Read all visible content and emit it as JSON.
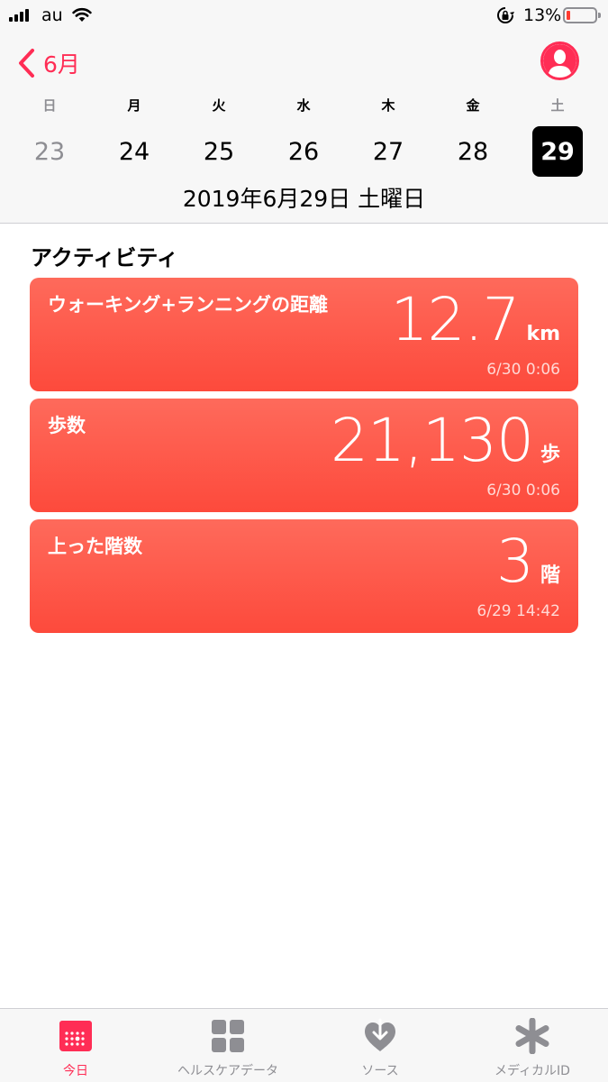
{
  "status_bar": {
    "carrier": "au",
    "battery_percent": "13%",
    "battery_level": 0.13
  },
  "header": {
    "back_label": "6月",
    "weekdays": [
      "日",
      "月",
      "火",
      "水",
      "木",
      "金",
      "土"
    ],
    "dates": [
      "23",
      "24",
      "25",
      "26",
      "27",
      "28",
      "29"
    ],
    "selected_index": 6,
    "full_date": "2019年6月29日 土曜日"
  },
  "section": {
    "title": "アクティビティ"
  },
  "cards": [
    {
      "title": "ウォーキング+ランニングの距離",
      "value": "12.7",
      "unit": "km",
      "time": "6/30 0:06"
    },
    {
      "title": "歩数",
      "value": "21,130",
      "unit": "歩",
      "time": "6/30 0:06"
    },
    {
      "title": "上った階数",
      "value": "3",
      "unit": "階",
      "time": "6/29 14:42"
    }
  ],
  "tabs": [
    {
      "label": "今日",
      "icon": "calendar-icon",
      "active": true
    },
    {
      "label": "ヘルスケアデータ",
      "icon": "grid-icon",
      "active": false
    },
    {
      "label": "ソース",
      "icon": "heart-download-icon",
      "active": false
    },
    {
      "label": "メディカルID",
      "icon": "asterisk-icon",
      "active": false
    }
  ],
  "colors": {
    "accent": "#ff2d55",
    "card_top": "#fe6a5b",
    "card_bottom": "#fd4a3c",
    "inactive": "#8e8e93"
  }
}
